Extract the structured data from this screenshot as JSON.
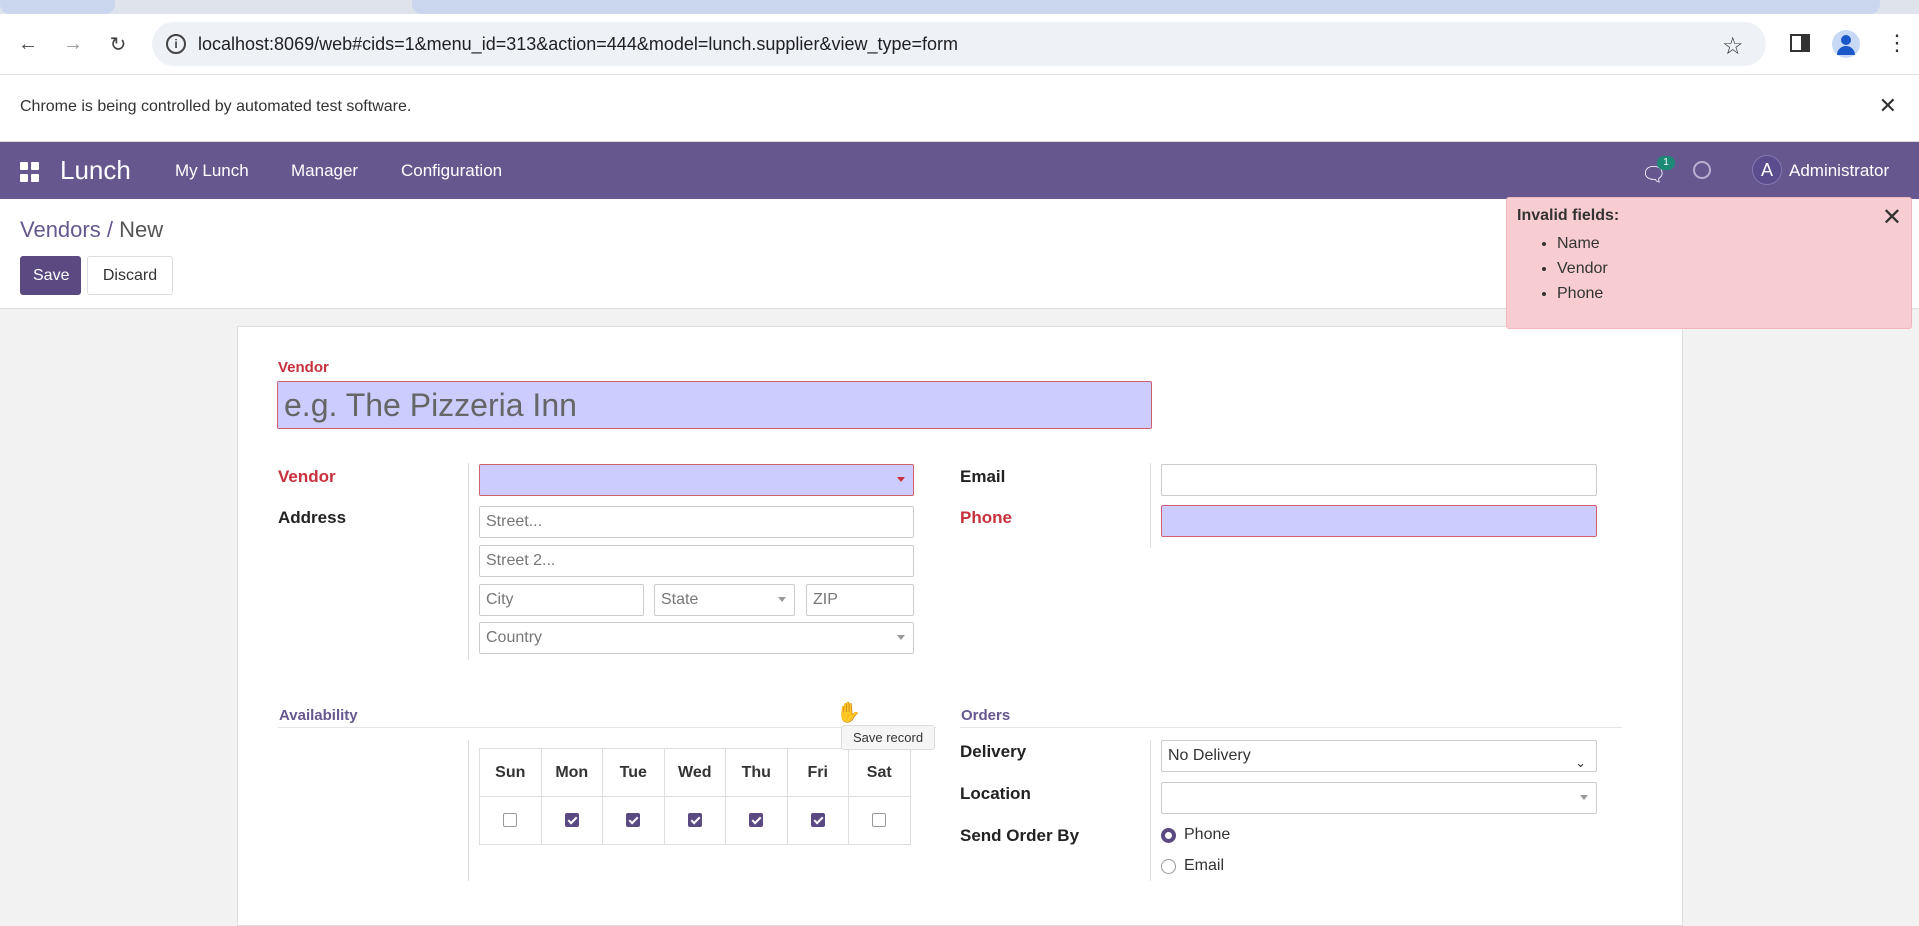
{
  "browser": {
    "url": "localhost:8069/web#cids=1&menu_id=313&action=444&model=lunch.supplier&view_type=form",
    "infobar_message": "Chrome is being controlled by automated test software."
  },
  "navbar": {
    "app_name": "Lunch",
    "menu": [
      "My Lunch",
      "Manager",
      "Configuration"
    ],
    "chat_badge": "1",
    "user_initial": "A",
    "user_name": "Administrator",
    "color": "#66578f"
  },
  "control": {
    "breadcrumb_parent": "Vendors",
    "breadcrumb_sep": " / ",
    "breadcrumb_current": "New",
    "save_label": "Save",
    "discard_label": "Discard"
  },
  "toast": {
    "title": "Invalid fields:",
    "items": [
      "Name",
      "Vendor",
      "Phone"
    ]
  },
  "form": {
    "name_label": "Vendor",
    "name_placeholder": "e.g. The Pizzeria Inn",
    "vendor_label": "Vendor",
    "address_label": "Address",
    "street_placeholder": "Street...",
    "street2_placeholder": "Street 2...",
    "city_placeholder": "City",
    "state_placeholder": "State",
    "zip_placeholder": "ZIP",
    "country_placeholder": "Country",
    "email_label": "Email",
    "phone_label": "Phone",
    "availability_label": "Availability",
    "orders_label": "Orders",
    "days": [
      "Sun",
      "Mon",
      "Tue",
      "Wed",
      "Thu",
      "Fri",
      "Sat"
    ],
    "days_checked": [
      false,
      true,
      true,
      true,
      true,
      true,
      false
    ],
    "delivery_label": "Delivery",
    "delivery_value": "No Delivery",
    "location_label": "Location",
    "send_order_label": "Send Order By",
    "send_order_options": [
      "Phone",
      "Email"
    ],
    "send_order_selected": "Phone"
  },
  "tooltip": "Save record"
}
